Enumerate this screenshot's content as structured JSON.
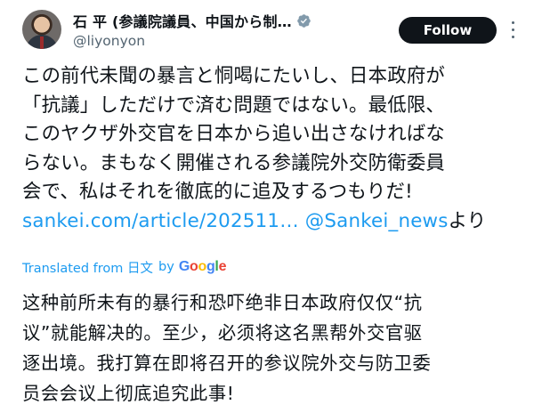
{
  "header": {
    "display_name": "石 平 (参議院議員、中国から制…",
    "handle": "@liyonyon",
    "follow_label": "Follow"
  },
  "tweet": {
    "lines": [
      "この前代未聞の暴言と恫喝にたいし、日本政府が",
      "「抗議」しただけで済む問題ではない。最低限、",
      "このヤクザ外交官を日本から追い出さなければな",
      "らない。まもなく開催される参議院外交防衛委員",
      "会で、私はそれを徹底的に追及するつもりだ!"
    ],
    "link_url": "sankei.com/article/202511…",
    "mention": "@Sankei_news",
    "mention_suffix": "より"
  },
  "translation": {
    "label": "Translated from 日文",
    "by": "by",
    "provider_letters": [
      "G",
      "o",
      "o",
      "g",
      "l",
      "e"
    ],
    "lines": [
      "这种前所未有的暴行和恐吓绝非日本政府仅仅“抗",
      "议”就能解决的。至少，必须将这名黑帮外交官驱",
      "逐出境。我打算在即将召开的参议院外交与防卫委",
      "员会会议上彻底追究此事!"
    ]
  },
  "colors": {
    "accent": "#1d9bf0",
    "text": "#0f1419",
    "secondary": "#536471",
    "button_bg": "#0f1419"
  },
  "icons": {
    "verified": "verified-badge-icon",
    "more": "more-vertical-icon",
    "avatar": "avatar"
  }
}
